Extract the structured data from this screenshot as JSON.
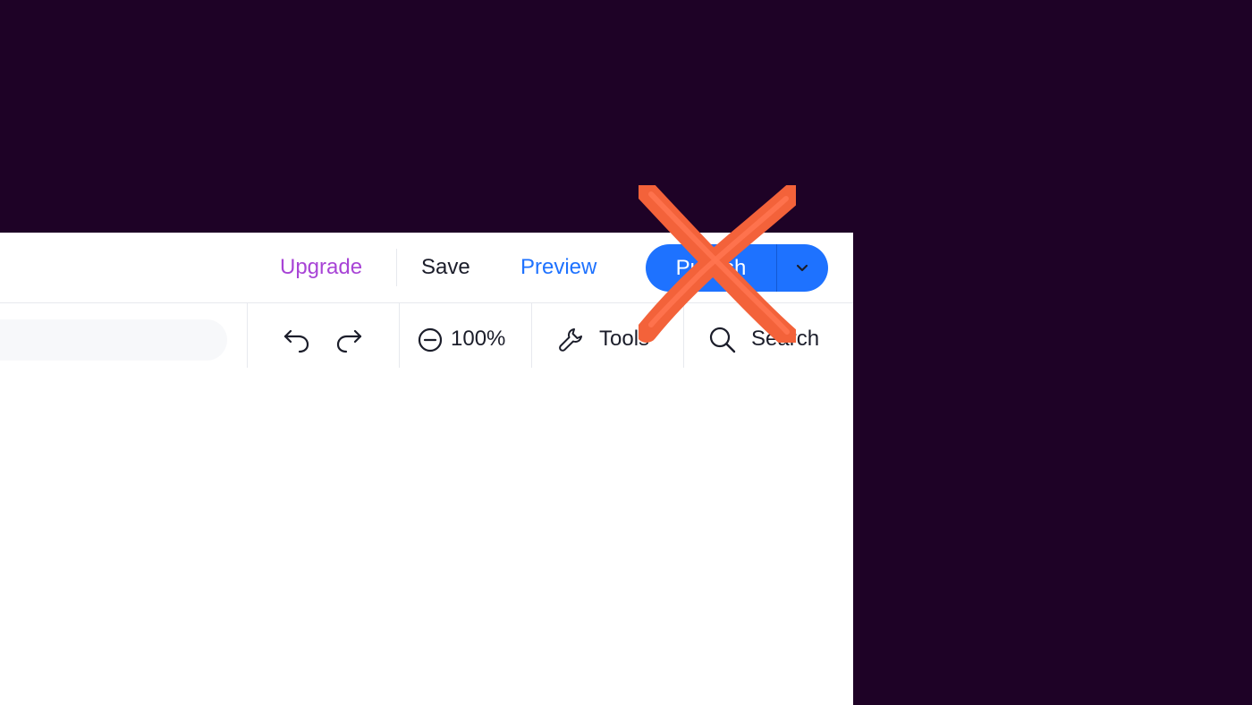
{
  "window": {
    "background_color": "#1e0226",
    "panel_color": "#ffffff"
  },
  "top_bar": {
    "upgrade_label": "Upgrade",
    "save_label": "Save",
    "preview_label": "Preview",
    "publish_label": "Publish",
    "publish_dropdown_icon": "chevron-down-icon",
    "colors": {
      "upgrade": "#a844d6",
      "preview": "#1e72ff",
      "publish_bg": "#1e72ff"
    }
  },
  "toolbar": {
    "address_field_value": "",
    "undo_icon": "undo-icon",
    "redo_icon": "redo-icon",
    "zoom_icon": "zoom-out-icon",
    "zoom_level": "100%",
    "tools_icon": "wrench-icon",
    "tools_label": "Tools",
    "search_icon": "search-icon",
    "search_label": "Search"
  },
  "overlay": {
    "mark": "red-x-mark",
    "color": "#f3623a"
  }
}
